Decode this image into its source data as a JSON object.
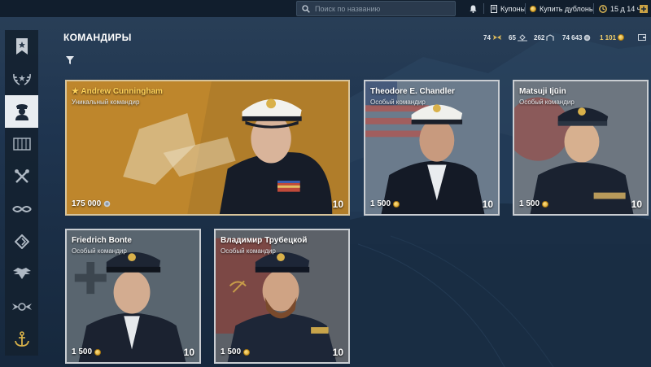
{
  "topbar": {
    "search_placeholder": "Поиск по названию",
    "coupons_label": "Купоны",
    "buy_doubloons_label": "Купить дублоны",
    "premium_time": "15 д 14 ч",
    "icons": {
      "search": "search-icon",
      "notifications": "bell-icon",
      "coupons": "coupon-icon",
      "buy": "doubloon-icon",
      "premium": "premium-clock-icon",
      "add": "plus-icon"
    }
  },
  "sidebar": {
    "items": [
      {
        "name": "flag",
        "icon": "flag-icon"
      },
      {
        "name": "laurel",
        "icon": "laurel-icon"
      },
      {
        "name": "commanders",
        "icon": "commander-icon",
        "active": true
      },
      {
        "name": "containers",
        "icon": "crate-icon"
      },
      {
        "name": "tools",
        "icon": "wrench-icon"
      },
      {
        "name": "signals",
        "icon": "rope-icon"
      },
      {
        "name": "camouflage",
        "icon": "diamond-icon"
      },
      {
        "name": "eagle",
        "icon": "eagle-icon"
      },
      {
        "name": "emblem",
        "icon": "winged-emblem-icon"
      },
      {
        "name": "anchor",
        "icon": "anchor-icon"
      }
    ]
  },
  "header": {
    "title": "КОМАНДИРЫ",
    "stats": {
      "ships": "74",
      "commanders": "65",
      "camo": "262",
      "credits": "74 643",
      "doubloons": "1 101"
    }
  },
  "cards": [
    {
      "name": "★ Andrew Cunningham",
      "subtitle": "Уникальный командир",
      "price": "175 000",
      "currency": "credits",
      "level": "10"
    },
    {
      "name": "Theodore E. Chandler",
      "subtitle": "Особый командир",
      "price": "1 500",
      "currency": "doubloons",
      "level": "10"
    },
    {
      "name": "Matsuji Ijūin",
      "subtitle": "Особый командир",
      "price": "1 500",
      "currency": "doubloons",
      "level": "10"
    },
    {
      "name": "Friedrich Bonte",
      "subtitle": "Особый командир",
      "price": "1 500",
      "currency": "doubloons",
      "level": "10"
    },
    {
      "name": "Владимир Трубецкой",
      "subtitle": "Особый командир",
      "price": "1 500",
      "currency": "doubloons",
      "level": "10"
    }
  ],
  "colors": {
    "accent_gold": "#ffd35a",
    "card_border": "#c9cdd2",
    "sidebar_active": "#e9edf1",
    "background": "#1f3550"
  }
}
